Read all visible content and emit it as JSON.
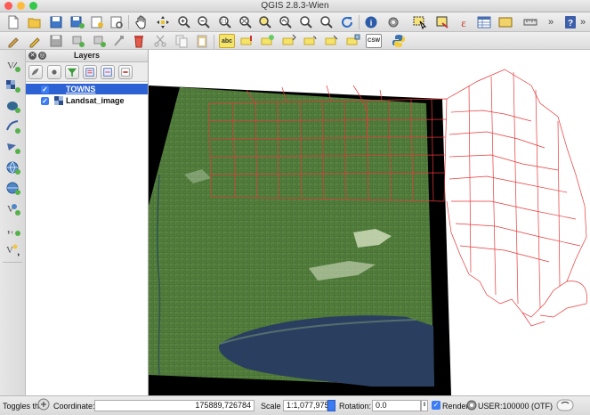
{
  "window": {
    "title": "QGIS 2.8.3-Wien"
  },
  "colors": {
    "towns_outline": "#e8383a",
    "selection": "#2c62d3"
  },
  "toolbar_top": {
    "icons": [
      "new-project-icon",
      "open-project-icon",
      "save-project-icon",
      "save-as-icon",
      "new-print-composer-icon",
      "composer-manager-icon",
      "pan-hand-icon",
      "pan-to-selection-icon",
      "zoom-in-icon",
      "zoom-out-icon",
      "zoom-native-icon",
      "zoom-full-icon",
      "zoom-to-selection-icon",
      "zoom-to-layer-icon",
      "refresh-icon",
      "identify-icon",
      "action-icon",
      "select-feature-icon",
      "deselect-icon",
      "field-calculator-icon",
      "open-attribute-table-icon",
      "measure-icon",
      "overflow-chevron-icon",
      "help-icon"
    ]
  },
  "toolbar_second": {
    "icons": [
      "current-edits-icon",
      "toggle-editing-icon",
      "save-layer-edits-icon",
      "add-feature-icon",
      "move-feature-icon",
      "node-tool-icon",
      "delete-selected-icon",
      "cut-features-icon",
      "copy-features-icon",
      "paste-features-icon",
      "label-icon",
      "label-pin-icon",
      "label-show-hide-icon",
      "label-move-icon",
      "label-rotate-icon",
      "label-change-icon",
      "csw-icon",
      "python-console-icon"
    ],
    "label_text": "abc",
    "csw_text": "CSW"
  },
  "left_toolbar": {
    "icons": [
      "add-vector-layer-icon",
      "add-raster-layer-icon",
      "add-postgis-layer-icon",
      "add-spatialite-layer-icon",
      "add-mssql-layer-icon",
      "add-wms-layer-icon",
      "add-wcs-layer-icon",
      "add-wfs-layer-icon",
      "add-delimited-text-icon",
      "new-shapefile-icon"
    ]
  },
  "layers_panel": {
    "title": "Layers",
    "layers": [
      {
        "name": "TOWNS",
        "checked": true,
        "selected": true
      },
      {
        "name": "Landsat_image",
        "checked": true,
        "selected": false
      }
    ]
  },
  "status_bar": {
    "toggles_label": "Toggles the",
    "coordinate_label": "Coordinate:",
    "coordinate_value": "175889,726784",
    "scale_label": "Scale",
    "scale_value": "1:1,077,975",
    "rotation_label": "Rotation:",
    "rotation_value": "0.0",
    "render_label": "Render",
    "crs_value": "USER:100000 (OTF)"
  }
}
